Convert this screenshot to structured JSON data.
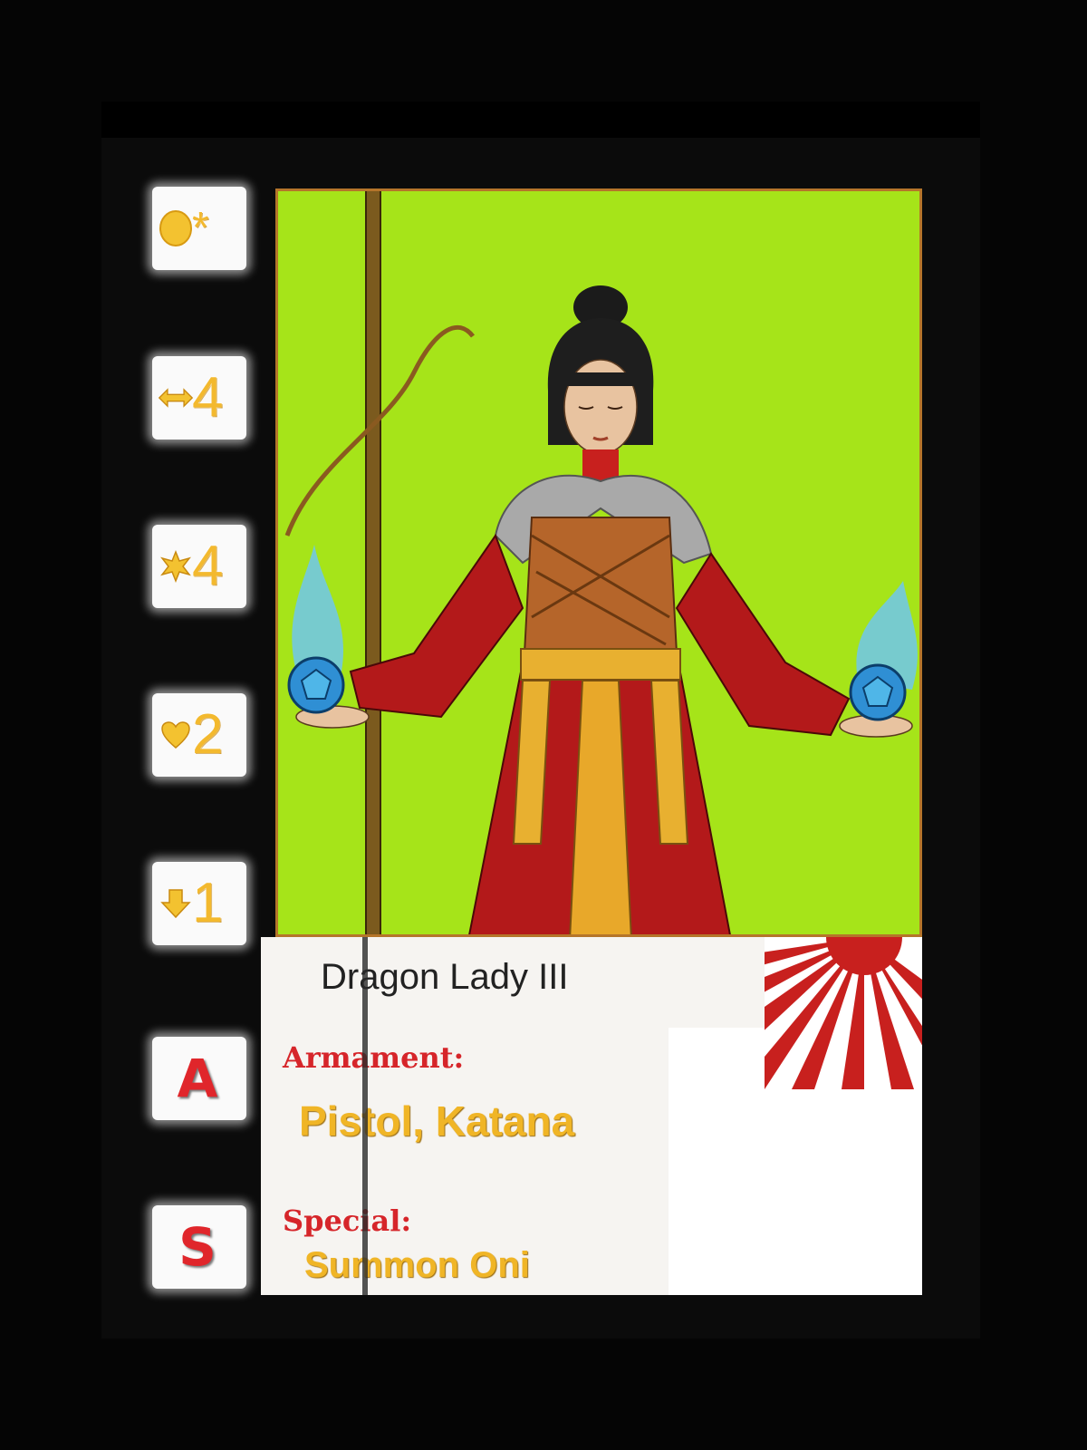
{
  "card": {
    "name": "Dragon Lady III",
    "armament_label": "Armament:",
    "armament_value": "Pistol, Katana",
    "special_label": "Special:",
    "special_value": "Summon Oni"
  },
  "stats": [
    {
      "icon": "coin-icon",
      "value": "*"
    },
    {
      "icon": "move-arrows-icon",
      "value": "4"
    },
    {
      "icon": "burst-icon",
      "value": "4"
    },
    {
      "icon": "heart-icon",
      "value": "2"
    },
    {
      "icon": "down-arrow-icon",
      "value": "1"
    }
  ],
  "letters": {
    "armament": "A",
    "special": "S"
  },
  "colors": {
    "background": "#050505",
    "art_background": "#a6e419",
    "stat_gold": "#f3b92e",
    "label_red": "#d6252a",
    "robe_red": "#b3191a",
    "flame_blue": "#4fb6e8"
  }
}
